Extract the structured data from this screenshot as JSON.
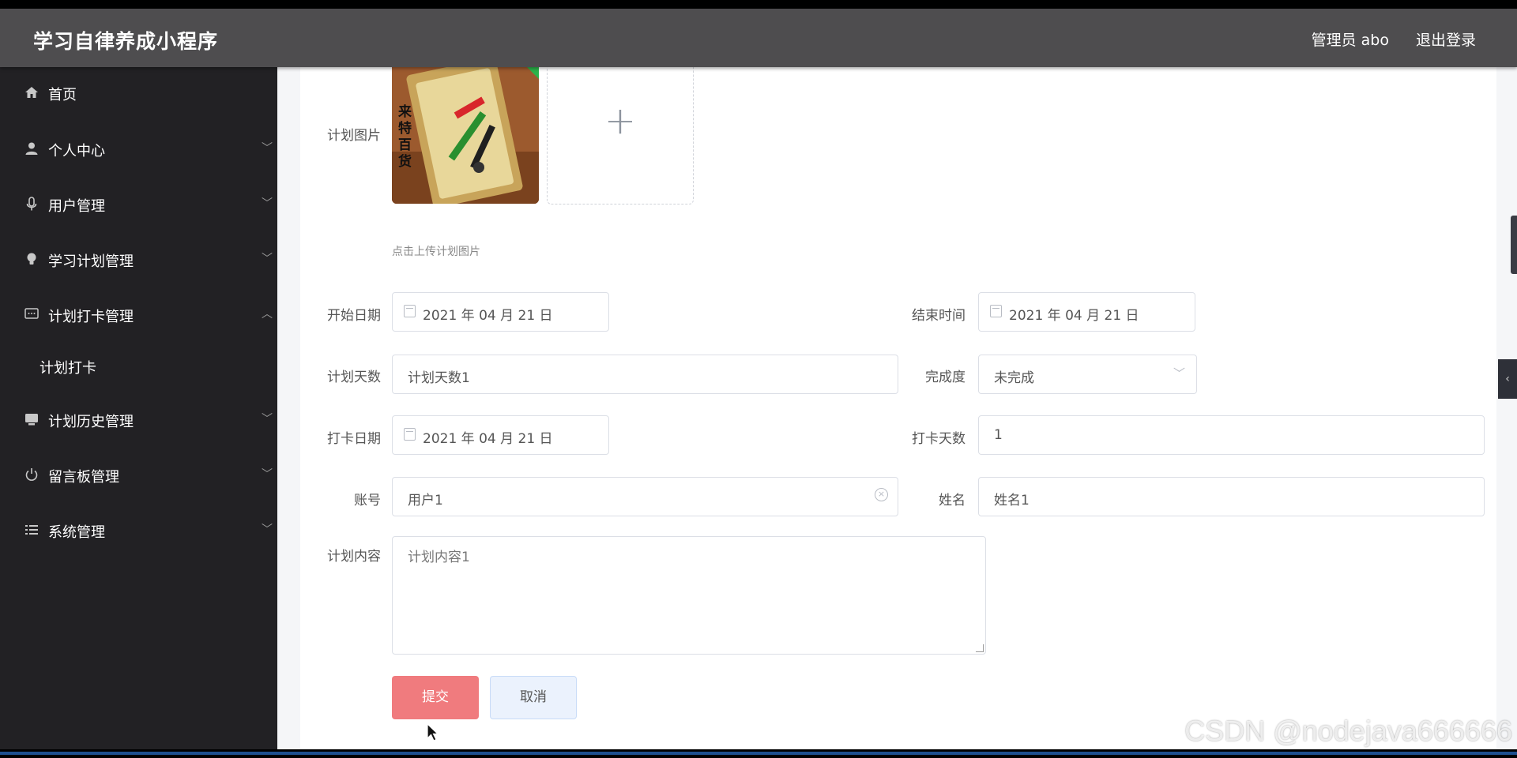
{
  "header": {
    "title": "学习自律养成小程序",
    "user_label": "管理员 abo",
    "logout_label": "退出登录"
  },
  "sidebar": {
    "items": [
      {
        "label": "首页",
        "icon": "home-icon"
      },
      {
        "label": "个人中心",
        "icon": "user-icon"
      },
      {
        "label": "用户管理",
        "icon": "microphone-icon"
      },
      {
        "label": "学习计划管理",
        "icon": "bulb-icon"
      },
      {
        "label": "计划打卡管理",
        "icon": "chat-icon"
      },
      {
        "label": "计划历史管理",
        "icon": "monitor-icon"
      },
      {
        "label": "留言板管理",
        "icon": "power-icon"
      },
      {
        "label": "系统管理",
        "icon": "list-icon"
      }
    ],
    "submenu": {
      "label": "计划打卡"
    }
  },
  "form": {
    "image": {
      "label": "计划图片",
      "upload_tip": "点击上传计划图片",
      "photo_text": "来特百货"
    },
    "start_date": {
      "label": "开始日期",
      "value": "2021 年 04 月 21 日"
    },
    "end_date": {
      "label": "结束时间",
      "value": "2021 年 04 月 21 日"
    },
    "plan_days": {
      "label": "计划天数",
      "value": "计划天数1"
    },
    "completion": {
      "label": "完成度",
      "value": "未完成"
    },
    "checkin_date": {
      "label": "打卡日期",
      "value": "2021 年 04 月 21 日"
    },
    "checkin_days": {
      "label": "打卡天数",
      "value": "1"
    },
    "account": {
      "label": "账号",
      "value": "用户1"
    },
    "name": {
      "label": "姓名",
      "value": "姓名1"
    },
    "plan_content": {
      "label": "计划内容",
      "value": "计划内容1"
    },
    "submit_label": "提交",
    "cancel_label": "取消"
  },
  "watermark": "CSDN @nodejava666666",
  "colors": {
    "header_bg": "#4e4d4f",
    "sidebar_bg": "#222124",
    "submit_bg": "#f07b7e",
    "cancel_bg": "#ebf2fd"
  }
}
